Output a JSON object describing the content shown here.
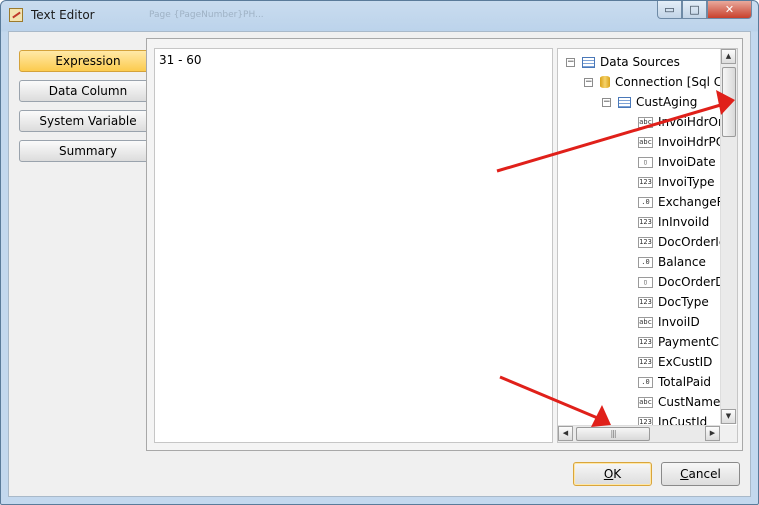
{
  "window": {
    "title": "Text Editor",
    "ghost_text": "Page {PageNumber}PH..."
  },
  "caption_buttons": {
    "minimize": "▭",
    "maximize": "□",
    "close": "✕"
  },
  "left_nav": [
    {
      "label": "Expression",
      "active": true
    },
    {
      "label": "Data Column",
      "active": false
    },
    {
      "label": "System Variable",
      "active": false
    },
    {
      "label": "Summary",
      "active": false
    }
  ],
  "editor": {
    "text": "31 - 60"
  },
  "tree": {
    "root": "Data Sources",
    "connection": "Connection [Sql Co",
    "table": "CustAging",
    "fields": [
      {
        "type": "abc",
        "name": "InvoiHdrOr"
      },
      {
        "type": "abc",
        "name": "InvoiHdrPO"
      },
      {
        "type": "date",
        "name": "InvoiDate"
      },
      {
        "type": "123",
        "name": "InvoiType"
      },
      {
        "type": ".0",
        "name": "ExchangeR"
      },
      {
        "type": "123",
        "name": "InInvoiId"
      },
      {
        "type": "123",
        "name": "DocOrderIc"
      },
      {
        "type": ".0",
        "name": "Balance"
      },
      {
        "type": "date",
        "name": "DocOrderD"
      },
      {
        "type": "123",
        "name": "DocType"
      },
      {
        "type": "abc",
        "name": "InvoiID"
      },
      {
        "type": "123",
        "name": "PaymentCr"
      },
      {
        "type": "123",
        "name": "ExCustID"
      },
      {
        "type": ".0",
        "name": "TotalPaid"
      },
      {
        "type": "abc",
        "name": "CustNameI"
      },
      {
        "type": "123",
        "name": "InCustId"
      }
    ]
  },
  "buttons": {
    "ok_label": "OK",
    "cancel_label": "Cancel"
  },
  "colors": {
    "arrow": "#e0201a",
    "active_tab": "#fccb4e",
    "title_bg": "#c9dcef"
  }
}
